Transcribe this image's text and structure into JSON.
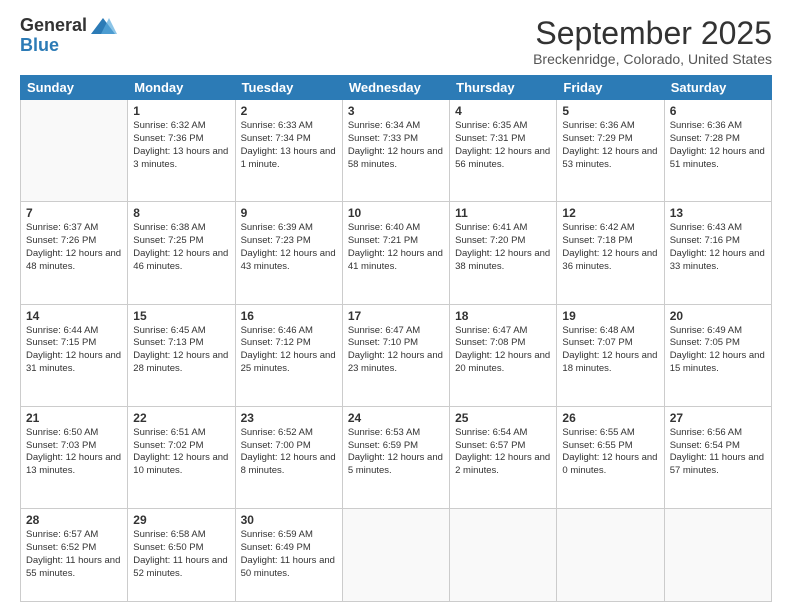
{
  "header": {
    "logo_general": "General",
    "logo_blue": "Blue",
    "month_title": "September 2025",
    "subtitle": "Breckenridge, Colorado, United States"
  },
  "weekdays": [
    "Sunday",
    "Monday",
    "Tuesday",
    "Wednesday",
    "Thursday",
    "Friday",
    "Saturday"
  ],
  "weeks": [
    [
      {
        "day": "",
        "sunrise": "",
        "sunset": "",
        "daylight": ""
      },
      {
        "day": "1",
        "sunrise": "Sunrise: 6:32 AM",
        "sunset": "Sunset: 7:36 PM",
        "daylight": "Daylight: 13 hours and 3 minutes."
      },
      {
        "day": "2",
        "sunrise": "Sunrise: 6:33 AM",
        "sunset": "Sunset: 7:34 PM",
        "daylight": "Daylight: 13 hours and 1 minute."
      },
      {
        "day": "3",
        "sunrise": "Sunrise: 6:34 AM",
        "sunset": "Sunset: 7:33 PM",
        "daylight": "Daylight: 12 hours and 58 minutes."
      },
      {
        "day": "4",
        "sunrise": "Sunrise: 6:35 AM",
        "sunset": "Sunset: 7:31 PM",
        "daylight": "Daylight: 12 hours and 56 minutes."
      },
      {
        "day": "5",
        "sunrise": "Sunrise: 6:36 AM",
        "sunset": "Sunset: 7:29 PM",
        "daylight": "Daylight: 12 hours and 53 minutes."
      },
      {
        "day": "6",
        "sunrise": "Sunrise: 6:36 AM",
        "sunset": "Sunset: 7:28 PM",
        "daylight": "Daylight: 12 hours and 51 minutes."
      }
    ],
    [
      {
        "day": "7",
        "sunrise": "Sunrise: 6:37 AM",
        "sunset": "Sunset: 7:26 PM",
        "daylight": "Daylight: 12 hours and 48 minutes."
      },
      {
        "day": "8",
        "sunrise": "Sunrise: 6:38 AM",
        "sunset": "Sunset: 7:25 PM",
        "daylight": "Daylight: 12 hours and 46 minutes."
      },
      {
        "day": "9",
        "sunrise": "Sunrise: 6:39 AM",
        "sunset": "Sunset: 7:23 PM",
        "daylight": "Daylight: 12 hours and 43 minutes."
      },
      {
        "day": "10",
        "sunrise": "Sunrise: 6:40 AM",
        "sunset": "Sunset: 7:21 PM",
        "daylight": "Daylight: 12 hours and 41 minutes."
      },
      {
        "day": "11",
        "sunrise": "Sunrise: 6:41 AM",
        "sunset": "Sunset: 7:20 PM",
        "daylight": "Daylight: 12 hours and 38 minutes."
      },
      {
        "day": "12",
        "sunrise": "Sunrise: 6:42 AM",
        "sunset": "Sunset: 7:18 PM",
        "daylight": "Daylight: 12 hours and 36 minutes."
      },
      {
        "day": "13",
        "sunrise": "Sunrise: 6:43 AM",
        "sunset": "Sunset: 7:16 PM",
        "daylight": "Daylight: 12 hours and 33 minutes."
      }
    ],
    [
      {
        "day": "14",
        "sunrise": "Sunrise: 6:44 AM",
        "sunset": "Sunset: 7:15 PM",
        "daylight": "Daylight: 12 hours and 31 minutes."
      },
      {
        "day": "15",
        "sunrise": "Sunrise: 6:45 AM",
        "sunset": "Sunset: 7:13 PM",
        "daylight": "Daylight: 12 hours and 28 minutes."
      },
      {
        "day": "16",
        "sunrise": "Sunrise: 6:46 AM",
        "sunset": "Sunset: 7:12 PM",
        "daylight": "Daylight: 12 hours and 25 minutes."
      },
      {
        "day": "17",
        "sunrise": "Sunrise: 6:47 AM",
        "sunset": "Sunset: 7:10 PM",
        "daylight": "Daylight: 12 hours and 23 minutes."
      },
      {
        "day": "18",
        "sunrise": "Sunrise: 6:47 AM",
        "sunset": "Sunset: 7:08 PM",
        "daylight": "Daylight: 12 hours and 20 minutes."
      },
      {
        "day": "19",
        "sunrise": "Sunrise: 6:48 AM",
        "sunset": "Sunset: 7:07 PM",
        "daylight": "Daylight: 12 hours and 18 minutes."
      },
      {
        "day": "20",
        "sunrise": "Sunrise: 6:49 AM",
        "sunset": "Sunset: 7:05 PM",
        "daylight": "Daylight: 12 hours and 15 minutes."
      }
    ],
    [
      {
        "day": "21",
        "sunrise": "Sunrise: 6:50 AM",
        "sunset": "Sunset: 7:03 PM",
        "daylight": "Daylight: 12 hours and 13 minutes."
      },
      {
        "day": "22",
        "sunrise": "Sunrise: 6:51 AM",
        "sunset": "Sunset: 7:02 PM",
        "daylight": "Daylight: 12 hours and 10 minutes."
      },
      {
        "day": "23",
        "sunrise": "Sunrise: 6:52 AM",
        "sunset": "Sunset: 7:00 PM",
        "daylight": "Daylight: 12 hours and 8 minutes."
      },
      {
        "day": "24",
        "sunrise": "Sunrise: 6:53 AM",
        "sunset": "Sunset: 6:59 PM",
        "daylight": "Daylight: 12 hours and 5 minutes."
      },
      {
        "day": "25",
        "sunrise": "Sunrise: 6:54 AM",
        "sunset": "Sunset: 6:57 PM",
        "daylight": "Daylight: 12 hours and 2 minutes."
      },
      {
        "day": "26",
        "sunrise": "Sunrise: 6:55 AM",
        "sunset": "Sunset: 6:55 PM",
        "daylight": "Daylight: 12 hours and 0 minutes."
      },
      {
        "day": "27",
        "sunrise": "Sunrise: 6:56 AM",
        "sunset": "Sunset: 6:54 PM",
        "daylight": "Daylight: 11 hours and 57 minutes."
      }
    ],
    [
      {
        "day": "28",
        "sunrise": "Sunrise: 6:57 AM",
        "sunset": "Sunset: 6:52 PM",
        "daylight": "Daylight: 11 hours and 55 minutes."
      },
      {
        "day": "29",
        "sunrise": "Sunrise: 6:58 AM",
        "sunset": "Sunset: 6:50 PM",
        "daylight": "Daylight: 11 hours and 52 minutes."
      },
      {
        "day": "30",
        "sunrise": "Sunrise: 6:59 AM",
        "sunset": "Sunset: 6:49 PM",
        "daylight": "Daylight: 11 hours and 50 minutes."
      },
      {
        "day": "",
        "sunrise": "",
        "sunset": "",
        "daylight": ""
      },
      {
        "day": "",
        "sunrise": "",
        "sunset": "",
        "daylight": ""
      },
      {
        "day": "",
        "sunrise": "",
        "sunset": "",
        "daylight": ""
      },
      {
        "day": "",
        "sunrise": "",
        "sunset": "",
        "daylight": ""
      }
    ]
  ]
}
